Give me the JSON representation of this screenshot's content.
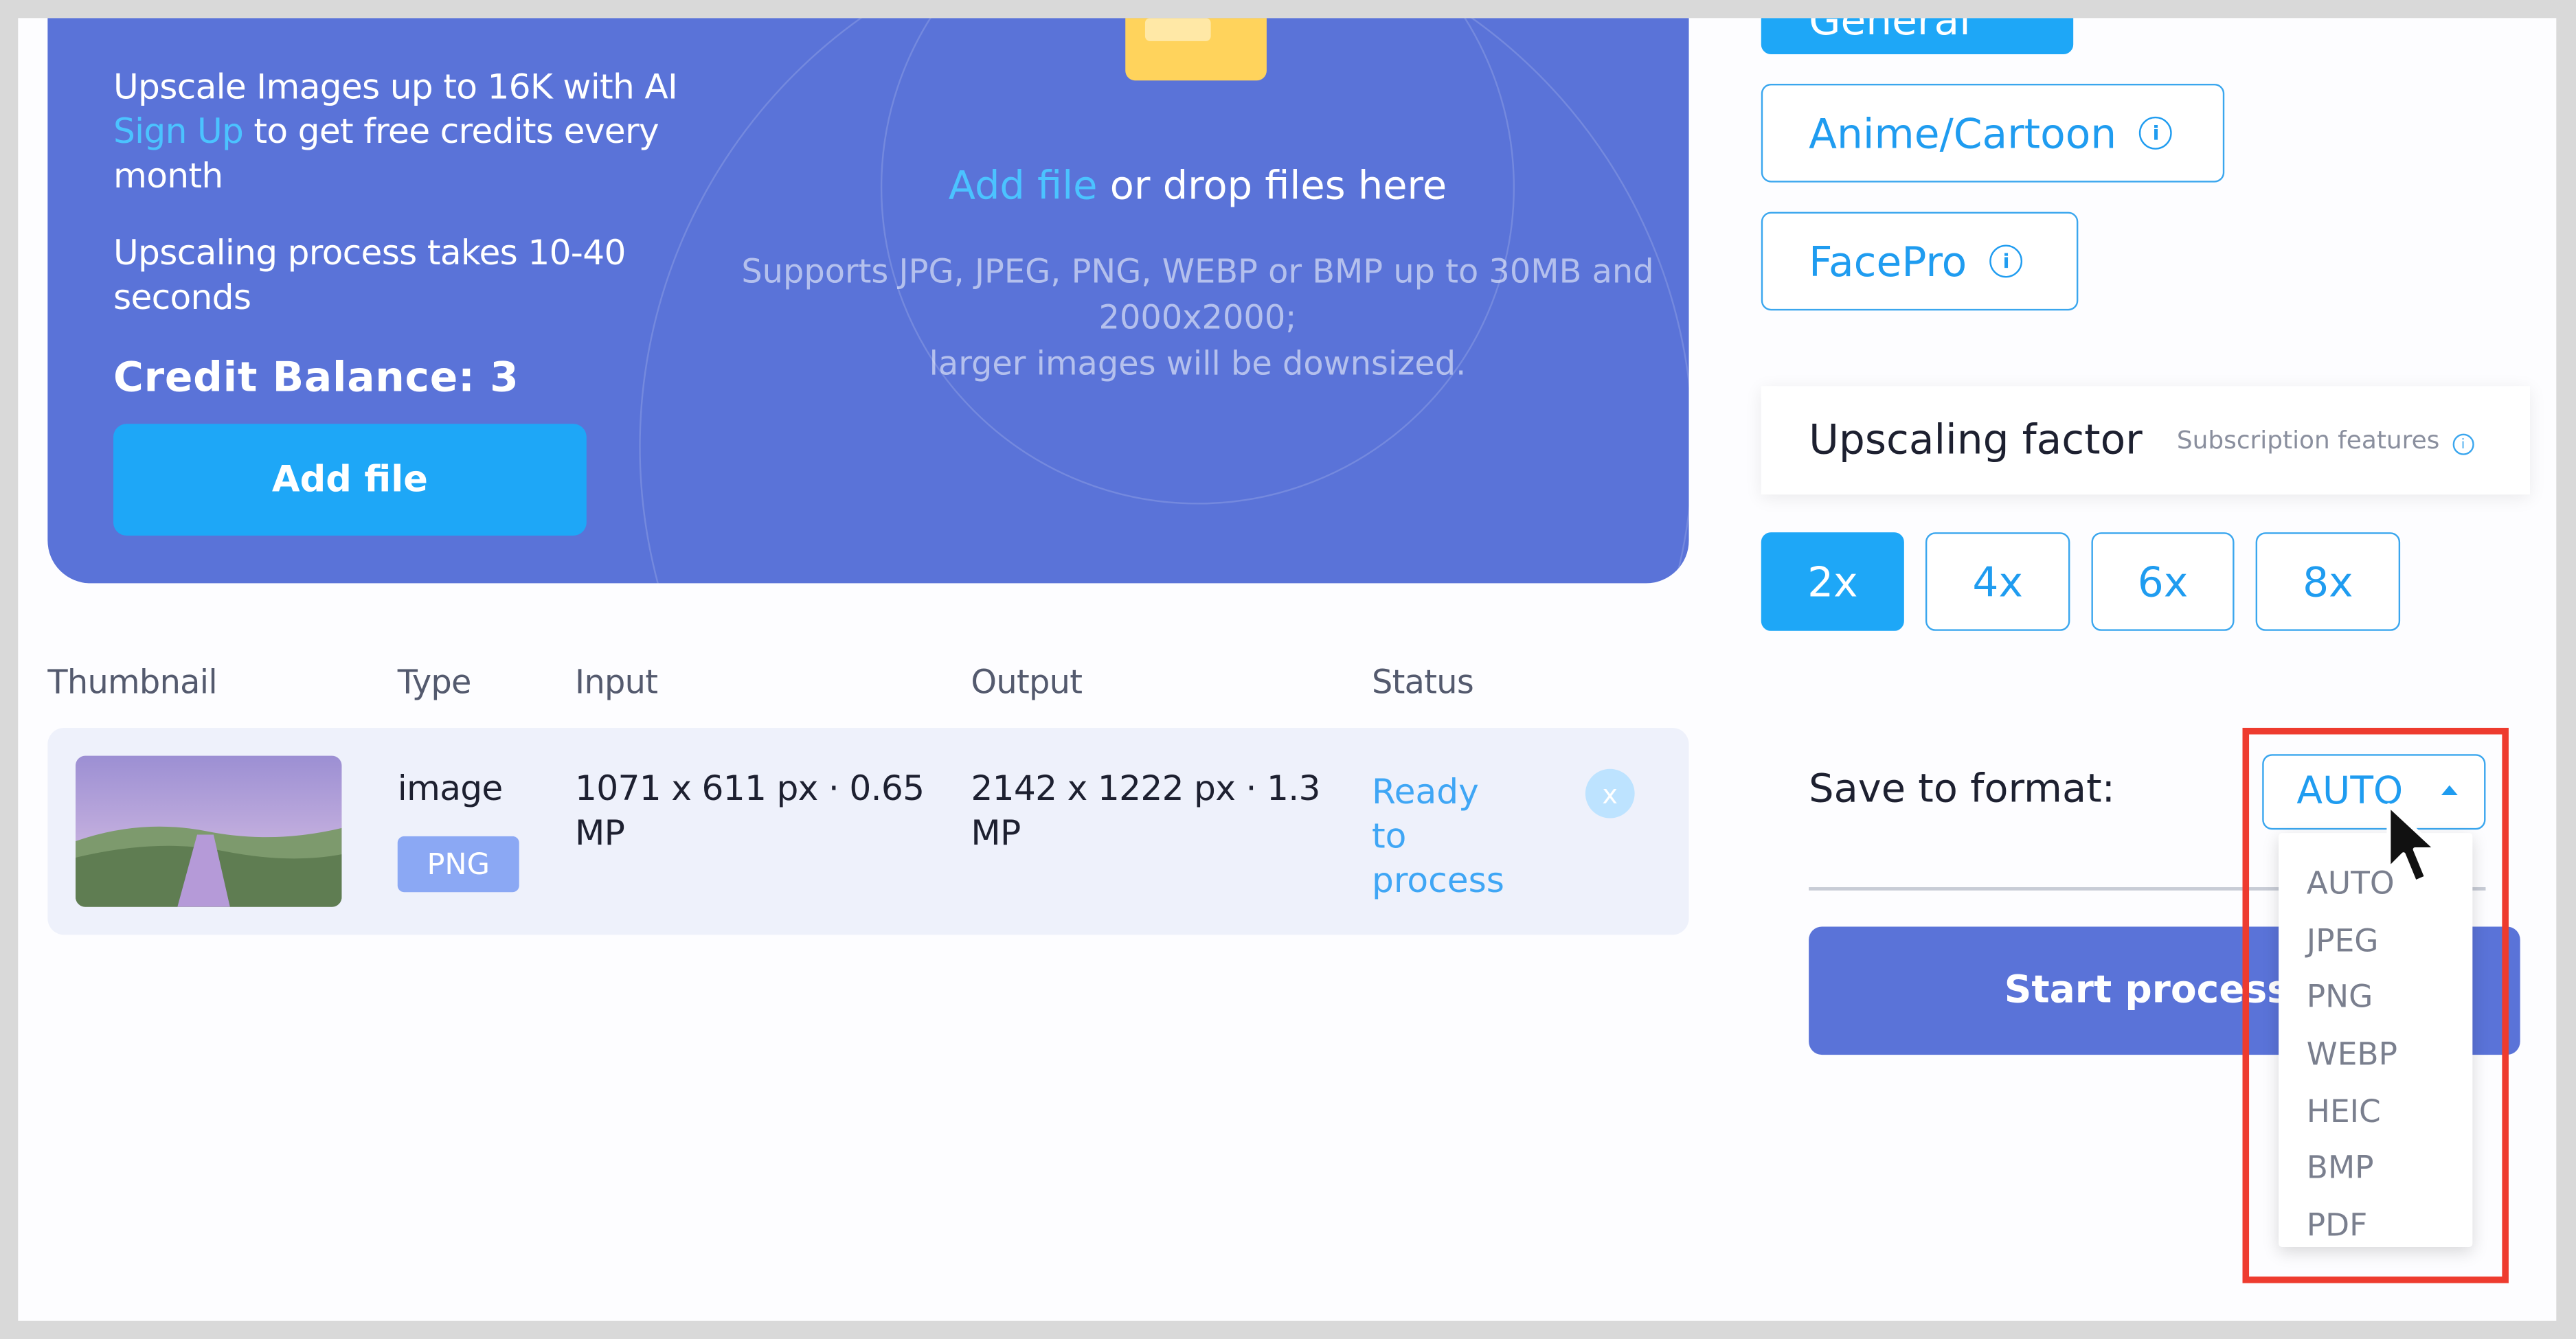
{
  "hero": {
    "line1": "Upscale Images up to 16K with AI",
    "signup_link": "Sign Up",
    "signup_rest": " to get free credits every",
    "line3": "month",
    "process_line1": "Upscaling process takes 10-40",
    "process_line2": "seconds",
    "credit_balance": "Credit Balance: 3",
    "add_file_button": "Add file",
    "drop_link": "Add file",
    "drop_text": " or drop files here",
    "supports_line1": "Supports JPG, JPEG, PNG, WEBP or BMP up to 30MB and",
    "supports_line2": "2000x2000;",
    "supports_line3": "larger images will be downsized."
  },
  "table": {
    "headers": [
      "Thumbnail",
      "Type",
      "Input",
      "Output",
      "Status"
    ],
    "row": {
      "type": "image",
      "badge": "PNG",
      "input_line1": "1071 x 611 px · 0.65",
      "input_line2": "MP",
      "output_line1": "2142 x 1222 px · 1.3",
      "output_line2": "MP",
      "status_line1": "Ready",
      "status_line2": "to",
      "status_line3": "process",
      "remove_label": "x"
    }
  },
  "models": {
    "general": "General",
    "anime": "Anime/Cartoon",
    "facepro": "FacePro",
    "info_glyph": "i"
  },
  "factor": {
    "title": "Upscaling factor",
    "subscription": "Subscription features",
    "options": [
      "2x",
      "4x",
      "6x",
      "8x"
    ],
    "selected": "2x"
  },
  "format": {
    "label": "Save to format:",
    "selected": "AUTO",
    "options": [
      "AUTO",
      "JPEG",
      "PNG",
      "WEBP",
      "HEIC",
      "BMP",
      "PDF"
    ]
  },
  "start_button": "Start processi",
  "colors": {
    "primary": "#5a73d8",
    "accent": "#1ea7f7",
    "highlight": "#ee3b2f"
  }
}
